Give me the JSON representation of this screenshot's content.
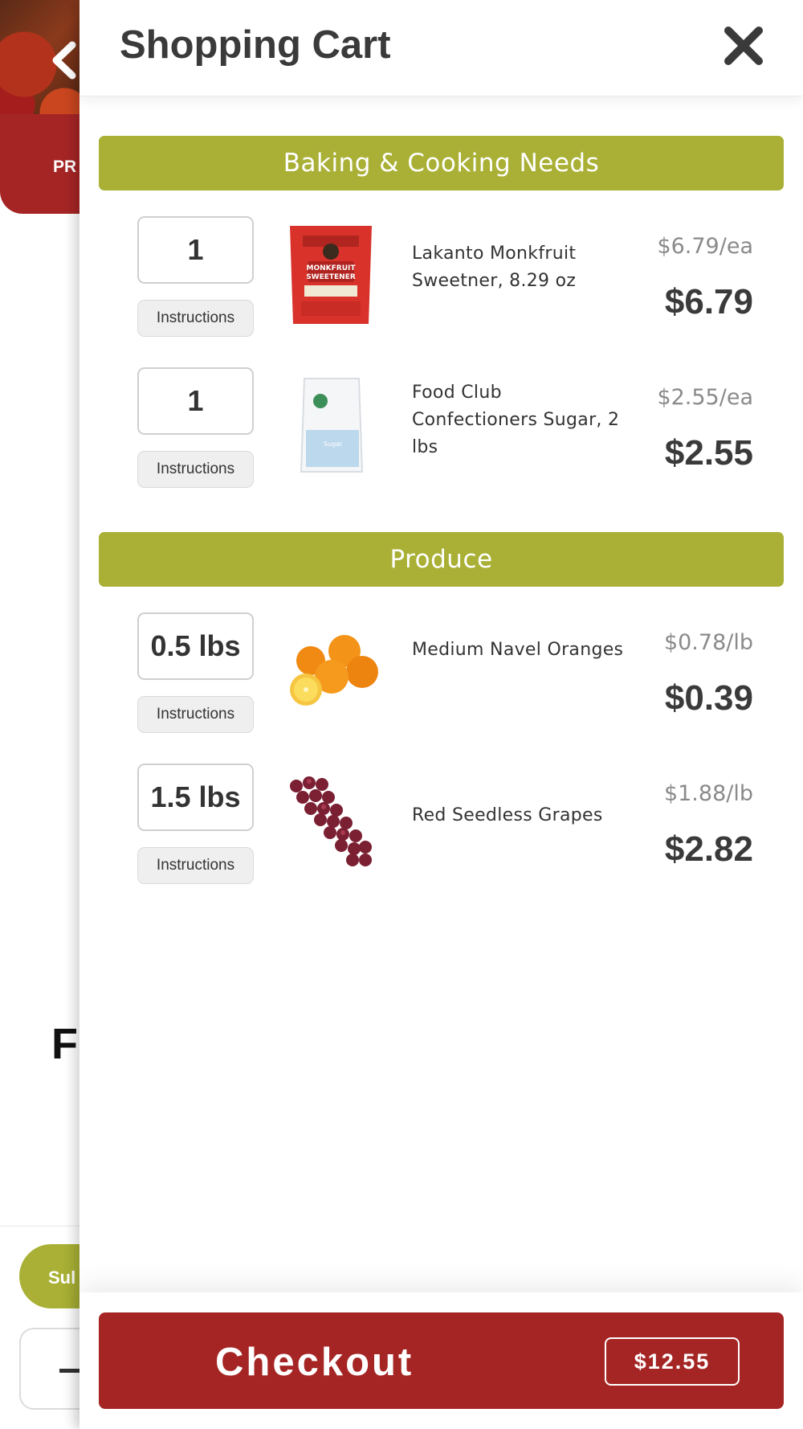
{
  "background": {
    "banner_label": "PR",
    "heading_fragment": "F",
    "subscribe_fragment": "Sul"
  },
  "cart": {
    "title": "Shopping Cart",
    "close_icon": "close-icon",
    "sections": [
      {
        "name": "Baking & Cooking Needs",
        "items": [
          {
            "quantity": "1",
            "instructions_label": "Instructions",
            "name": "Lakanto Monkfruit Sweetner, 8.29 oz",
            "unit_price": "$6.79/ea",
            "total": "$6.79",
            "image_icon": "sweetener-bag-icon"
          },
          {
            "quantity": "1",
            "instructions_label": "Instructions",
            "name": "Food Club Confectioners Sugar, 2 lbs",
            "unit_price": "$2.55/ea",
            "total": "$2.55",
            "image_icon": "sugar-bag-icon"
          }
        ]
      },
      {
        "name": "Produce",
        "items": [
          {
            "quantity": "0.5 lbs",
            "instructions_label": "Instructions",
            "name": "Medium Navel Oranges",
            "unit_price": "$0.78/lb",
            "total": "$0.39",
            "image_icon": "oranges-icon"
          },
          {
            "quantity": "1.5 lbs",
            "instructions_label": "Instructions",
            "name": "Red Seedless Grapes",
            "unit_price": "$1.88/lb",
            "total": "$2.82",
            "image_icon": "grapes-icon"
          }
        ]
      }
    ],
    "checkout": {
      "label": "Checkout",
      "total": "$12.55"
    }
  },
  "colors": {
    "accent_green": "#a9b035",
    "brand_red": "#a52524",
    "text_dark": "#3a3a3a",
    "text_muted": "#8a8a8a"
  }
}
